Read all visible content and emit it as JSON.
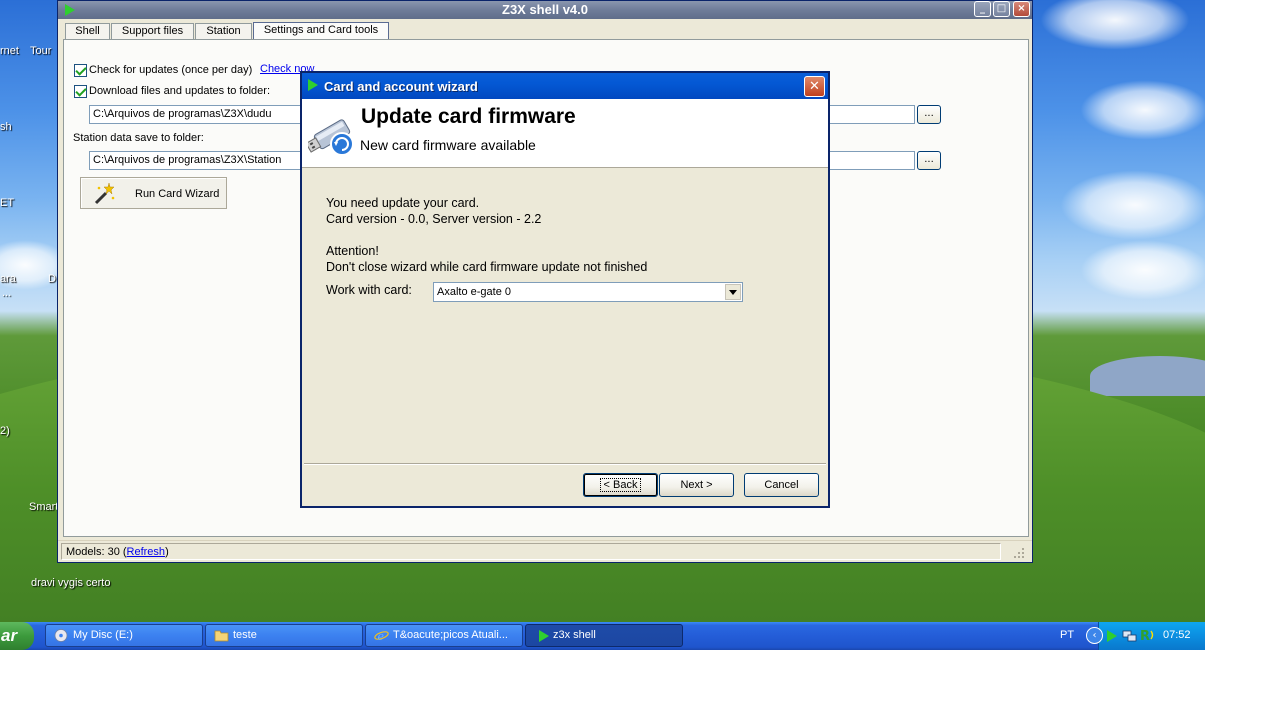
{
  "desktop": {
    "icon_labels": [
      "rnet",
      "Tour",
      "sh",
      "ET",
      "ara",
      "D",
      "...",
      "2)",
      "Smart",
      "dravi vygis certo"
    ]
  },
  "main_window": {
    "title": "Z3X shell v4.0",
    "tabs": [
      {
        "label": "Shell"
      },
      {
        "label": "Support files"
      },
      {
        "label": "Station"
      },
      {
        "label": "Settings and Card tools",
        "active": true
      }
    ],
    "settings": {
      "check_updates_label": "Check for updates (once per day)",
      "check_now_link": "Check now",
      "download_label": "Download files and updates to folder:",
      "download_path": "C:\\Arquivos de programas\\Z3X\\dudu",
      "station_label": "Station data save to folder:",
      "station_path": "C:\\Arquivos de programas\\Z3X\\Station",
      "browse_label": "...",
      "run_wizard_label": "Run Card Wizard"
    },
    "statusbar": {
      "models_prefix": "Models: 30 (",
      "refresh_link": "Refresh",
      "models_suffix": ")"
    }
  },
  "dialog": {
    "title": "Card and account wizard",
    "heading": "Update card firmware",
    "subheading": "New card firmware available",
    "line1": "You need update your card.",
    "line2": "Card version - 0.0, Server version - 2.2",
    "line3": "Attention!",
    "line4": "Don't close wizard while card firmware update not finished",
    "work_with_label": "Work with card:",
    "card_value": "Axalto e-gate 0",
    "back_label": "< Back",
    "next_label": "Next >",
    "cancel_label": "Cancel"
  },
  "taskbar": {
    "start_label": "ar",
    "items": [
      {
        "label": "My Disc (E:)"
      },
      {
        "label": "teste"
      },
      {
        "label": "T&oacute;picos Atuali..."
      },
      {
        "label": "z3x shell",
        "active": true
      }
    ],
    "language": "PT",
    "clock": "07:52"
  },
  "colors": {
    "title_active": "#0458d4",
    "title_inactive": "#6e7c99",
    "taskbar": "#245dd8",
    "tray": "#0b8ee0",
    "play_icon": "#2fcf2f"
  }
}
